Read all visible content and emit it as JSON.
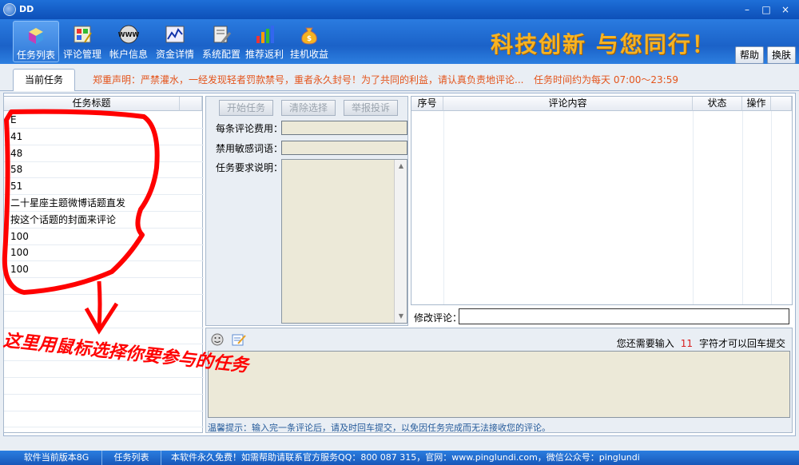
{
  "window": {
    "title": "DD",
    "min": "–",
    "max": "□",
    "close": "×"
  },
  "toolbar": {
    "items": [
      {
        "label": "任务列表",
        "icon": "cube-icon"
      },
      {
        "label": "评论管理",
        "icon": "palette-icon"
      },
      {
        "label": "帐户信息",
        "icon": "www-globe-icon"
      },
      {
        "label": "资金详情",
        "icon": "line-chart-icon"
      },
      {
        "label": "系统配置",
        "icon": "config-tools-icon"
      },
      {
        "label": "推荐返利",
        "icon": "bar-chart-icon"
      },
      {
        "label": "挂机收益",
        "icon": "money-bag-icon"
      }
    ],
    "slogan": "科技创新  与您同行！",
    "help": "帮助",
    "skin": "换肤"
  },
  "tabs": {
    "current": "当前任务",
    "notice": "郑重声明：严禁灌水，一经发现轻者罚款禁号，重者永久封号！为了共同的利益，请认真负责地评论...",
    "time": "任务时间约为每天 07:00～23:59"
  },
  "task_list": {
    "header": "任务标题",
    "rows": [
      "E",
      "41",
      "48",
      "58",
      "51",
      "二十星座主题微博话题直发",
      "按这个话题的封面来评论",
      "100",
      "100",
      "100"
    ]
  },
  "middle": {
    "start": "开始任务",
    "clear": "清除选择",
    "report": "举报投诉",
    "fee_label": "每条评论费用：",
    "banned_label": "禁用敏感词语：",
    "req_label": "任务要求说明："
  },
  "comments": {
    "headers": [
      "序号",
      "评论内容",
      "状态",
      "操作"
    ],
    "modify_label": "修改评论："
  },
  "editor": {
    "need_prefix": "您还需要输入",
    "need_count": "11",
    "need_suffix": "字符才可以回车提交",
    "hint": "温馨提示：输入完一条评论后，请及时回车提交，以免因任务完成而无法接收您的评论。"
  },
  "annotation": {
    "line1": "这里用鼠标选择你要参与的任务"
  },
  "statusbar": {
    "version": "软件当前版本8G",
    "page": "任务列表",
    "info": "本软件永久免费！如需帮助请联系官方服务QQ：800 087 315，官网：www.pinglundi.com，微信公众号：pinglundi"
  },
  "colors": {
    "accent": "#1b62c8",
    "warning": "#e4541b",
    "annotation": "#ff0000",
    "slogan": "#f6b323"
  }
}
